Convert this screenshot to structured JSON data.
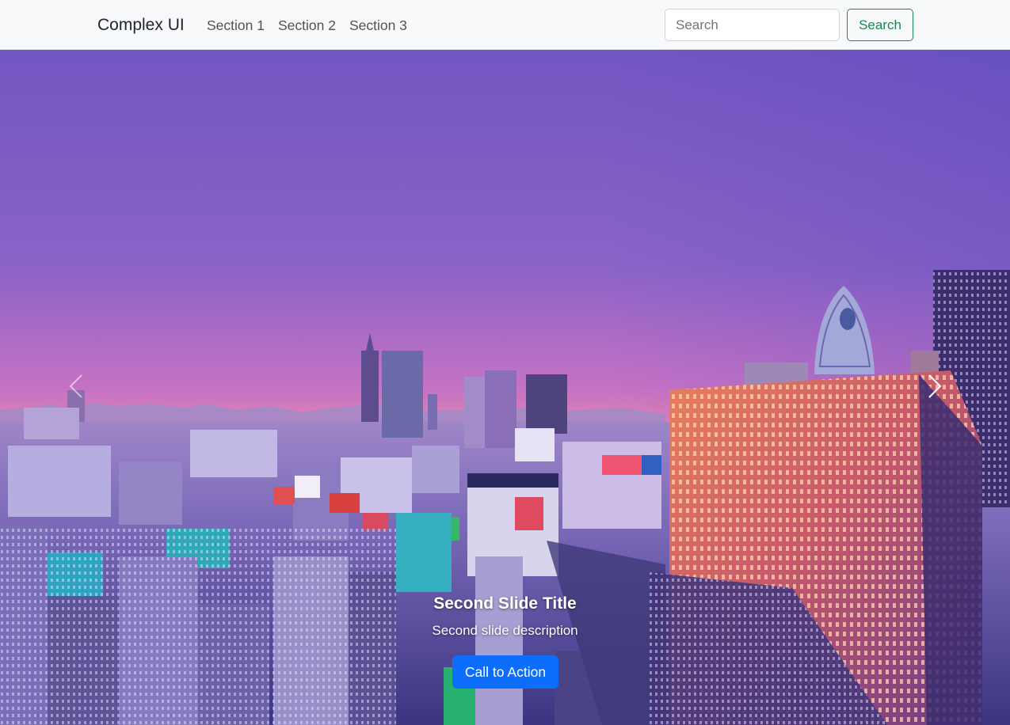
{
  "navbar": {
    "brand": "Complex UI",
    "links": [
      "Section 1",
      "Section 2",
      "Section 3"
    ],
    "search_placeholder": "Search",
    "search_button": "Search"
  },
  "carousel": {
    "slide_title": "Second Slide Title",
    "slide_description": "Second slide description",
    "cta_label": "Call to Action",
    "prev_icon": "chevron-left-icon",
    "next_icon": "chevron-right-icon"
  },
  "colors": {
    "navbar_bg": "#f8f9fa",
    "success": "#198754",
    "primary": "#0d6efd"
  }
}
